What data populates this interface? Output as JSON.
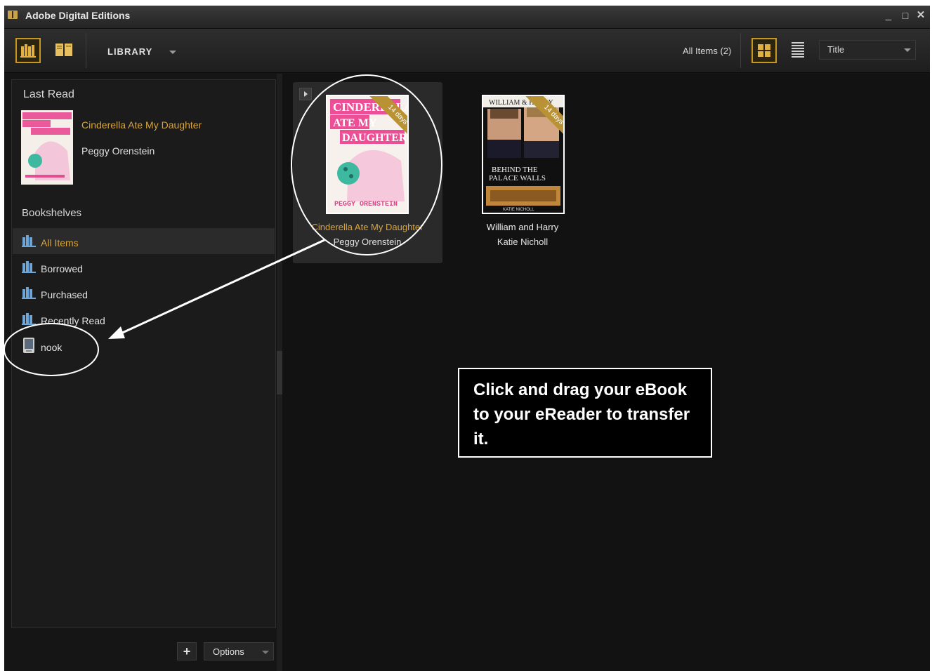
{
  "window": {
    "title": "Adobe Digital Editions",
    "minimize": "_",
    "maximize": "□",
    "close": "✕"
  },
  "toolbar": {
    "library_label": "LIBRARY",
    "items_label": "All Items",
    "items_count": "(2)",
    "sort_value": "Title"
  },
  "sidebar": {
    "last_read_heading": "Last Read",
    "last_read": {
      "title": "Cinderella Ate My Daughter",
      "author": "Peggy Orenstein"
    },
    "bookshelves_heading": "Bookshelves",
    "shelves": [
      {
        "label": "All Items",
        "selected": true,
        "icon": "bookshelf-icon"
      },
      {
        "label": "Borrowed",
        "icon": "bookshelf-icon"
      },
      {
        "label": "Purchased",
        "icon": "bookshelf-icon"
      },
      {
        "label": "Recently Read",
        "icon": "bookshelf-icon"
      },
      {
        "label": "nook",
        "icon": "ereader-device-icon"
      }
    ],
    "add_button": "+",
    "options_label": "Options"
  },
  "books": [
    {
      "title": "Cinderella Ate My Daughter",
      "author": "Peggy Orenstein",
      "badge": "14 days",
      "cover_text": [
        "CINDERELLA",
        "ATE MY",
        "DAUGHTER",
        "PEGGY ORENSTEIN"
      ]
    },
    {
      "title": "William and Harry",
      "author": "Katie Nicholl",
      "badge": "14 days",
      "cover_text": [
        "WILLIAM & HARRY",
        "BEHIND THE",
        "PALACE WALLS",
        "KATIE NICHOLL"
      ]
    }
  ],
  "callout": {
    "text": "Click and drag your eBook to your eReader to transfer it."
  },
  "colors": {
    "accent": "#c8971f",
    "selected_text": "#d9a43a",
    "background": "#151515"
  }
}
